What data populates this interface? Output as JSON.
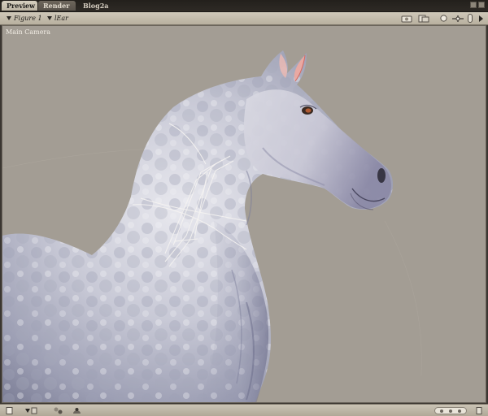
{
  "tabs": [
    {
      "label": "Preview",
      "state": "active"
    },
    {
      "label": "Render",
      "state": "inactive"
    },
    {
      "label": "Blog2a",
      "state": "plain"
    }
  ],
  "toolbar": {
    "figure_menu": "Figure 1",
    "part_menu": "lEar",
    "icons": [
      "camera-icon",
      "fly-icon",
      "render-style-icon",
      "move-icon",
      "lights-icon",
      "arrow-right-icon"
    ]
  },
  "viewport": {
    "camera_label": "Main Camera",
    "background_color": "#a39d94",
    "subject": "horse"
  },
  "bottombar": {
    "icons": [
      "document-icon",
      "arrow-down-icon",
      "figure-icon",
      "dome-icon",
      "display-pill-icon",
      "right-edge-icon"
    ]
  },
  "colors": {
    "chrome": "#c9c1b2",
    "chrome_dark": "#2b2824",
    "viewport_bg": "#a39d94"
  }
}
